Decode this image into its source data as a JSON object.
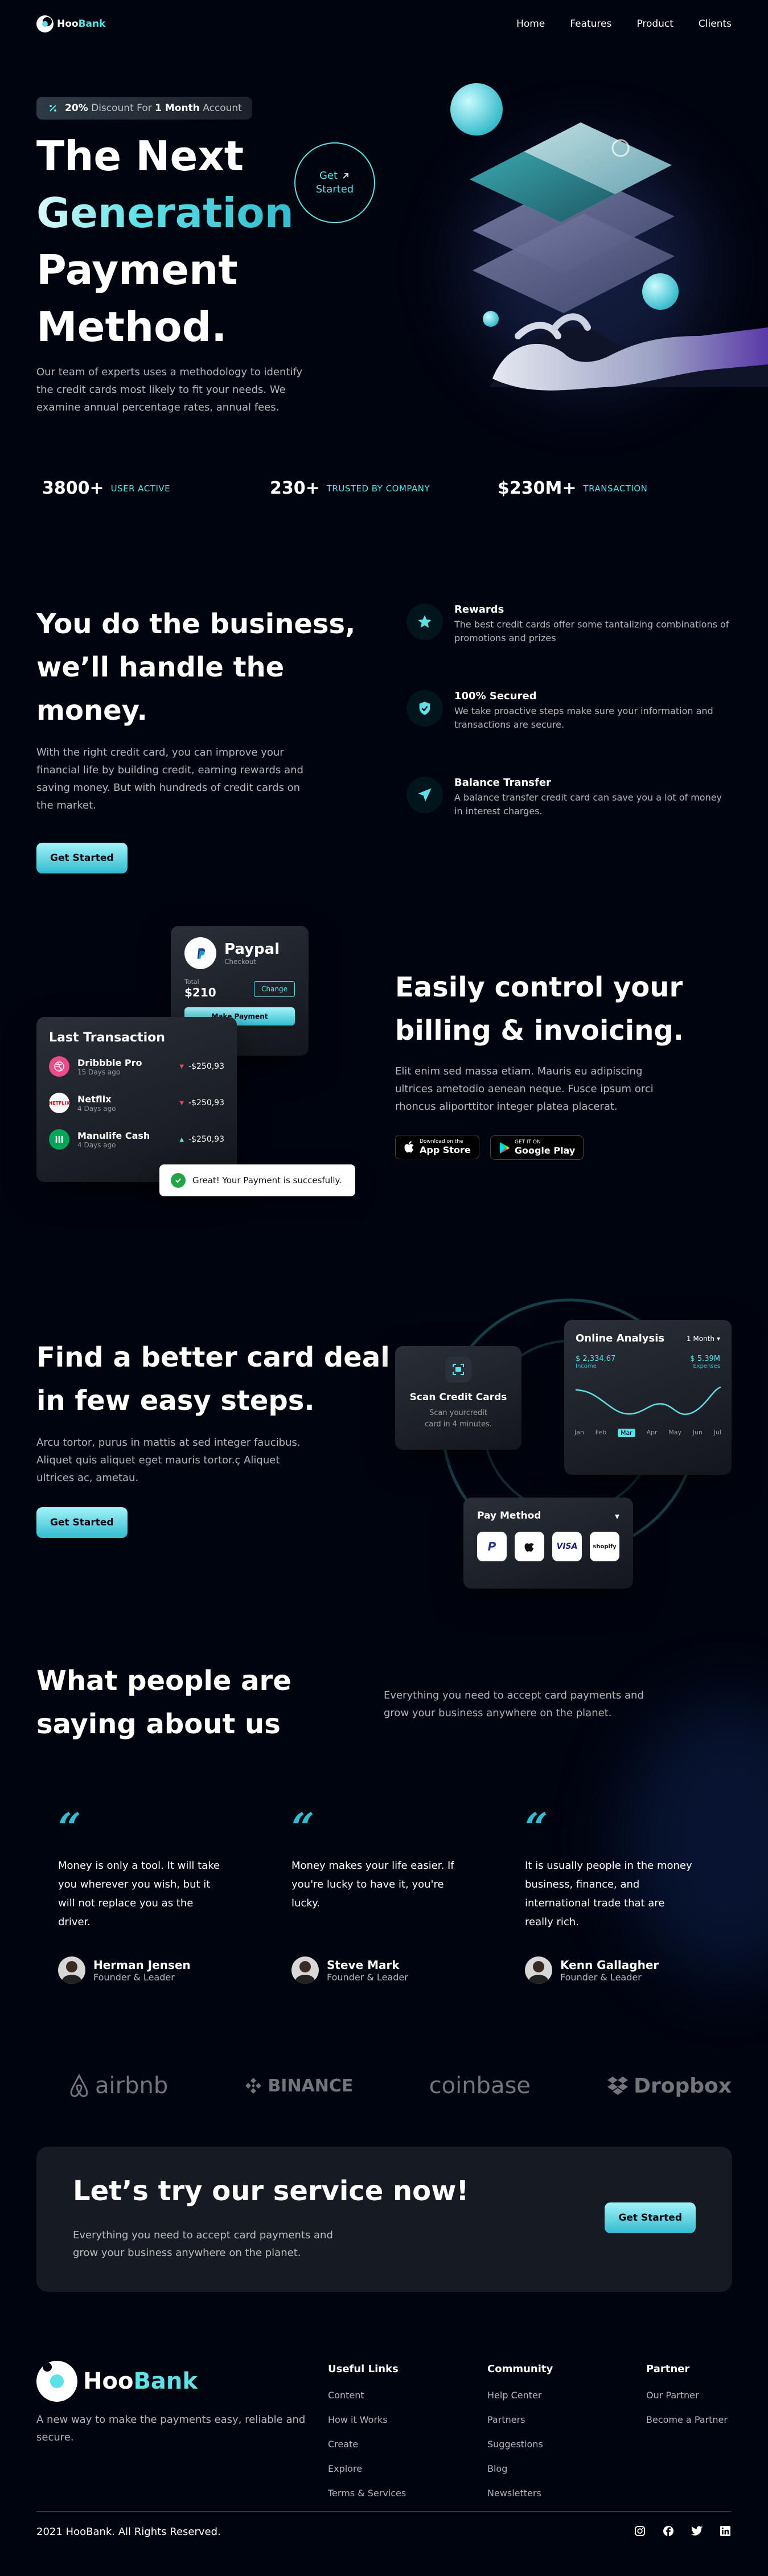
{
  "brand": {
    "name_hoo": "Hoo",
    "name_bank": "Bank"
  },
  "nav": {
    "items": [
      "Home",
      "Features",
      "Product",
      "Clients"
    ]
  },
  "hero": {
    "badge_percent": "20%",
    "badge_mid": " Discount For ",
    "badge_month": "1 Month",
    "badge_end": " Account",
    "title_line1": "The Next",
    "title_line2": "Generation",
    "title_line3": "Payment",
    "title_line4": "Method.",
    "cta_line1": "Get",
    "cta_line2": "Started",
    "paragraph": "Our team of experts uses a methodology to identify the credit cards most likely to fit your needs. We examine annual percentage rates, annual fees."
  },
  "stats": [
    {
      "value": "3800+",
      "label": "USER ACTIVE"
    },
    {
      "value": "230+",
      "label": "TRUSTED BY COMPANY"
    },
    {
      "value": "$230M+",
      "label": "TRANSACTION"
    }
  ],
  "business": {
    "title_line1": "You do the business,",
    "title_line2": "we’ll handle the money.",
    "paragraph": "With the right credit card, you can improve your financial life by building credit, earning rewards and saving money. But with hundreds of credit cards on the market.",
    "button": "Get Started",
    "features": [
      {
        "icon": "star-icon",
        "title": "Rewards",
        "text": "The best credit cards offer some tantalizing combinations of promotions and prizes"
      },
      {
        "icon": "shield-icon",
        "title": "100% Secured",
        "text": "We take proactive steps make sure your information and transactions are secure."
      },
      {
        "icon": "send-icon",
        "title": "Balance Transfer",
        "text": "A balance transfer credit card can save you a lot of money in interest charges."
      }
    ]
  },
  "billing": {
    "paypal_title": "Paypal",
    "paypal_sub": "Checkout",
    "total_label": "Total",
    "total_value": "$210",
    "change_button": "Change",
    "make_payment": "Make Payment",
    "tx_title": "Last Transaction",
    "transactions": [
      {
        "name": "Dribbble Pro",
        "date": "15 Days ago",
        "amount": "-$250,93"
      },
      {
        "name": "Netflix",
        "date": "4 Days ago",
        "amount": "-$250,93"
      },
      {
        "name": "Manulife Cash",
        "date": "4 Days ago",
        "amount": "-$250,93"
      }
    ],
    "toast": "Great! Your Payment is succesfully.",
    "title_line1": "Easily control your",
    "title_line2": "billing & invoicing.",
    "paragraph": "Elit enim sed massa etiam. Mauris eu adipiscing ultrices ametodio aenean neque. Fusce ipsum orci rhoncus aliporttitor integer platea placerat.",
    "appstore_small": "Download on the",
    "appstore_big": "App Store",
    "google_small": "GET IT ON",
    "google_big": "Google Play"
  },
  "steps": {
    "title_line1": "Find a better card deal",
    "title_line2": "in few easy steps.",
    "paragraph": "Arcu tortor, purus in mattis at sed integer faucibus. Aliquet quis aliquet eget mauris tortor.ç Aliquet ultrices ac, ametau.",
    "button": "Get Started",
    "scan_title": "Scan Credit Cards",
    "scan_text": "Scan yourcredit card in 4 minutes.",
    "analysis_title": "Online Analysis",
    "analysis_period": "1 Month",
    "income_value": "$ 2,334,67",
    "income_label": "Income",
    "expense_value": "$ 5.39M",
    "expense_label": "Expenses",
    "months": [
      "Jan",
      "Feb",
      "Mar",
      "Apr",
      "May",
      "Jun",
      "Jul"
    ],
    "active_month": "Mar",
    "paymethod_title": "Pay Method",
    "pay_logos": [
      "P",
      "",
      "VISA",
      "shopify"
    ]
  },
  "testimonials": {
    "title_line1": "What people are",
    "title_line2": "saying about us",
    "intro": "Everything you need to accept card payments and grow your business anywhere on the planet.",
    "items": [
      {
        "text": "Money is only a tool. It will take you wherever you wish, but it will not replace you as the driver.",
        "name": "Herman Jensen",
        "role": "Founder & Leader"
      },
      {
        "text": "Money makes your life easier. If you're lucky to have it, you're lucky.",
        "name": "Steve Mark",
        "role": "Founder & Leader"
      },
      {
        "text": "It is usually people in the money business, finance, and international trade that are really rich.",
        "name": "Kenn Gallagher",
        "role": "Founder & Leader"
      }
    ]
  },
  "partners": [
    "airbnb",
    "BINANCE",
    "coinbase",
    "Dropbox"
  ],
  "cta": {
    "title": "Let’s try our service now!",
    "text": "Everything you need to accept card payments and grow your business anywhere on the planet.",
    "button": "Get Started"
  },
  "footer": {
    "tagline": "A new way to make the payments easy, reliable and secure.",
    "columns": [
      {
        "title": "Useful Links",
        "links": [
          "Content",
          "How it Works",
          "Create",
          "Explore",
          "Terms & Services"
        ]
      },
      {
        "title": "Community",
        "links": [
          "Help Center",
          "Partners",
          "Suggestions",
          "Blog",
          "Newsletters"
        ]
      },
      {
        "title": "Partner",
        "links": [
          "Our Partner",
          "Become a Partner"
        ]
      }
    ],
    "copyright": "2021 HooBank. All Rights Reserved."
  },
  "colors": {
    "accent": "#5ce1e6",
    "accent_dark": "#33bbcf",
    "background": "#00040f"
  }
}
